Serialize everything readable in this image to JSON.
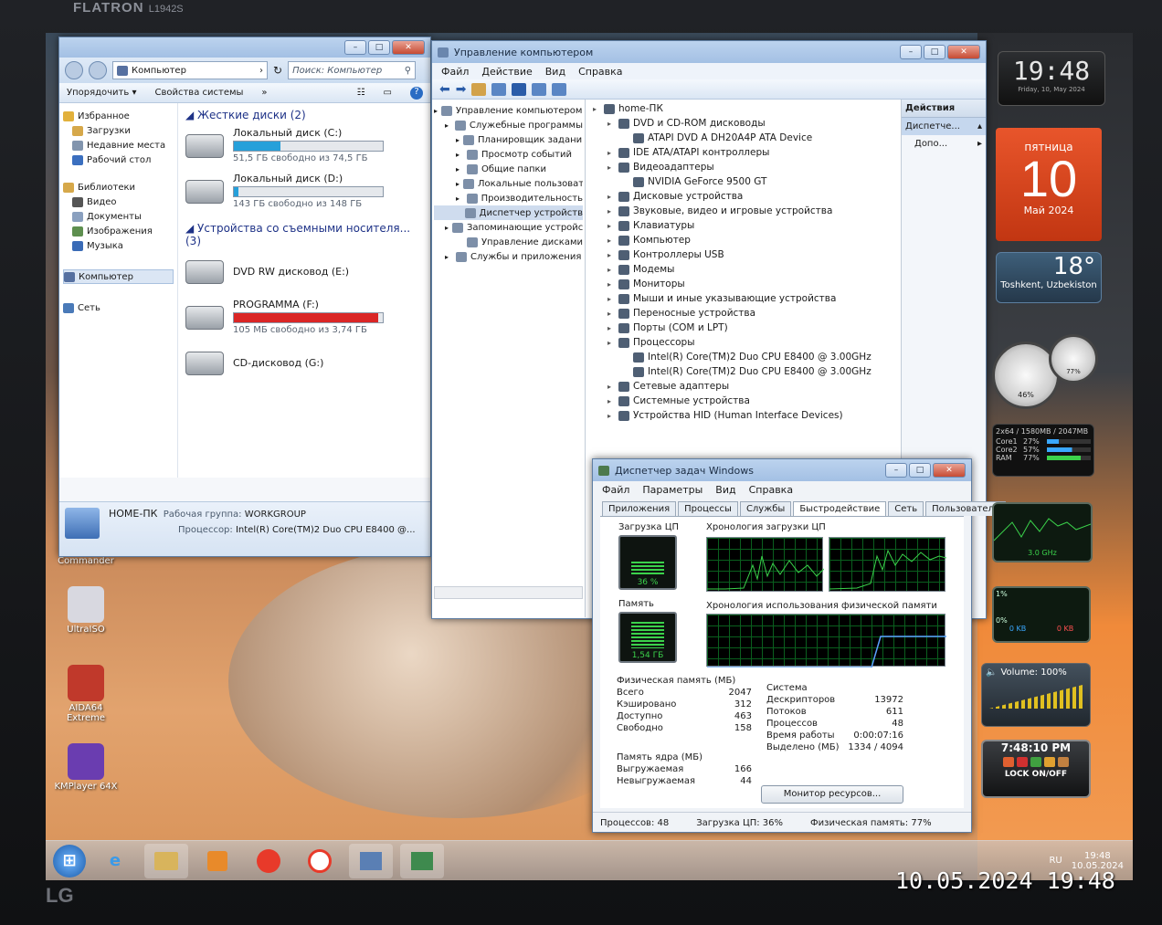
{
  "bezel": {
    "brand": "FLATRON",
    "model": "L1942S",
    "maker": "LG"
  },
  "photo_stamp": "10.05.2024  19:48",
  "explorer": {
    "address": "Компьютер",
    "search_placeholder": "Поиск: Компьютер",
    "organize": "Упорядочить",
    "system_props": "Свойства системы",
    "more": "»",
    "nav": {
      "favorites": "Избранное",
      "downloads": "Загрузки",
      "recent": "Недавние места",
      "desktop": "Рабочий стол",
      "libraries": "Библиотеки",
      "video": "Видео",
      "documents": "Документы",
      "images": "Изображения",
      "music": "Музыка",
      "computer": "Компьютер",
      "network": "Сеть"
    },
    "hdd_header": "Жесткие диски (2)",
    "removable_header": "Устройства со съемными носителя... (3)",
    "drives": [
      {
        "name": "Локальный диск (C:)",
        "free": "51,5 ГБ свободно из 74,5 ГБ",
        "used_fraction": 0.31,
        "color": "#26a0da"
      },
      {
        "name": "Локальный диск (D:)",
        "free": "143 ГБ свободно из 148 ГБ",
        "used_fraction": 0.03,
        "color": "#26a0da"
      }
    ],
    "removables": [
      {
        "name": "DVD RW дисковод (E:)"
      },
      {
        "name": "PROGRAMMA (F:)",
        "free": "105 МБ свободно из 3,74 ГБ",
        "used_fraction": 0.97,
        "color": "#da2626"
      },
      {
        "name": "CD-дисковод (G:)"
      }
    ],
    "status": {
      "pc": "HOME-ПК",
      "wg_label": "Рабочая группа:",
      "wg": "WORKGROUP",
      "cpu_label": "Процессор:",
      "cpu": "Intel(R) Core(TM)2 Duo CPU     E8400  @..."
    }
  },
  "mgmt": {
    "title": "Управление компьютером",
    "menu": [
      "Файл",
      "Действие",
      "Вид",
      "Справка"
    ],
    "tree": [
      {
        "label": "Управление компьютером (л",
        "lvl": 0
      },
      {
        "label": "Служебные программы",
        "lvl": 1
      },
      {
        "label": "Планировщик заданий",
        "lvl": 2
      },
      {
        "label": "Просмотр событий",
        "lvl": 2
      },
      {
        "label": "Общие папки",
        "lvl": 2
      },
      {
        "label": "Локальные пользовате",
        "lvl": 2
      },
      {
        "label": "Производительность",
        "lvl": 2
      },
      {
        "label": "Диспетчер устройств",
        "lvl": 2
      },
      {
        "label": "Запоминающие устройст",
        "lvl": 1
      },
      {
        "label": "Управление дисками",
        "lvl": 2
      },
      {
        "label": "Службы и приложения",
        "lvl": 1
      }
    ],
    "devices": [
      {
        "label": "home-ПК",
        "lvl": 0
      },
      {
        "label": "DVD и CD-ROM дисководы",
        "lvl": 1
      },
      {
        "label": "ATAPI DVD A  DH20A4P ATA Device",
        "lvl": 2
      },
      {
        "label": "IDE ATA/ATAPI контроллеры",
        "lvl": 1
      },
      {
        "label": "Видеоадаптеры",
        "lvl": 1
      },
      {
        "label": "NVIDIA GeForce 9500 GT",
        "lvl": 2
      },
      {
        "label": "Дисковые устройства",
        "lvl": 1
      },
      {
        "label": "Звуковые, видео и игровые устройства",
        "lvl": 1
      },
      {
        "label": "Клавиатуры",
        "lvl": 1
      },
      {
        "label": "Компьютер",
        "lvl": 1
      },
      {
        "label": "Контроллеры USB",
        "lvl": 1
      },
      {
        "label": "Модемы",
        "lvl": 1
      },
      {
        "label": "Мониторы",
        "lvl": 1
      },
      {
        "label": "Мыши и иные указывающие устройства",
        "lvl": 1
      },
      {
        "label": "Переносные устройства",
        "lvl": 1
      },
      {
        "label": "Порты (COM и LPT)",
        "lvl": 1
      },
      {
        "label": "Процессоры",
        "lvl": 1
      },
      {
        "label": "Intel(R) Core(TM)2 Duo CPU     E8400  @ 3.00GHz",
        "lvl": 2
      },
      {
        "label": "Intel(R) Core(TM)2 Duo CPU     E8400  @ 3.00GHz",
        "lvl": 2
      },
      {
        "label": "Сетевые адаптеры",
        "lvl": 1
      },
      {
        "label": "Системные устройства",
        "lvl": 1
      },
      {
        "label": "Устройства HID (Human Interface Devices)",
        "lvl": 1
      }
    ],
    "actions": {
      "title": "Действия",
      "item": "Диспетче...",
      "more": "Допо..."
    }
  },
  "taskmgr": {
    "title": "Диспетчер задач Windows",
    "menu": [
      "Файл",
      "Параметры",
      "Вид",
      "Справка"
    ],
    "tabs": [
      "Приложения",
      "Процессы",
      "Службы",
      "Быстродействие",
      "Сеть",
      "Пользователи"
    ],
    "active_tab": 3,
    "cpu_label": "Загрузка ЦП",
    "cpu_value": "36 %",
    "cpu_fraction": 0.36,
    "cpu_hist_label": "Хронология загрузки ЦП",
    "mem_label": "Память",
    "mem_value": "1,54 ГБ",
    "mem_fraction": 0.77,
    "mem_hist_label": "Хронология использования физической памяти",
    "phys_header": "Физическая память (МБ)",
    "phys": [
      [
        "Всего",
        "2047"
      ],
      [
        "Кэшировано",
        "312"
      ],
      [
        "Доступно",
        "463"
      ],
      [
        "Свободно",
        "158"
      ]
    ],
    "kernel_header": "Память ядра (МБ)",
    "kernel": [
      [
        "Выгружаемая",
        "166"
      ],
      [
        "Невыгружаемая",
        "44"
      ]
    ],
    "sys_header": "Система",
    "sys": [
      [
        "Дескрипторов",
        "13972"
      ],
      [
        "Потоков",
        "611"
      ],
      [
        "Процессов",
        "48"
      ],
      [
        "Время работы",
        "0:00:07:16"
      ],
      [
        "Выделено (МБ)",
        "1334 / 4094"
      ]
    ],
    "resmon": "Монитор ресурсов...",
    "status": {
      "procs": "Процессов: 48",
      "cpu": "Загрузка ЦП: 36%",
      "mem": "Физическая память: 77%"
    }
  },
  "desktop_icons": [
    {
      "label": "Total Commander",
      "color": "#c8c8c8"
    },
    {
      "label": "UltraISO",
      "color": "#d8d8e0"
    },
    {
      "label": "AIDA64 Extreme",
      "color": "#c0392b"
    },
    {
      "label": "KMPlayer 64X",
      "color": "#6a3db0"
    }
  ],
  "gadgets": {
    "clock": "19:48",
    "clock_date": "Friday, 10, May 2024",
    "calendar_weekday": "пятница",
    "calendar_day": "10",
    "calendar_month": "Май 2024",
    "weather_temp": "18°",
    "weather_city": "Toshkent, Uzbekiston",
    "cpu_gauge": "46%",
    "ram_gauge": "77%",
    "meter_header": "2x64 / 1580MB / 2047MB",
    "core1": "27%",
    "core2": "57%",
    "ram": "77%",
    "core1_label": "Core1",
    "core2_label": "Core2",
    "ram_label": "RAM",
    "freq": "3.0 GHz",
    "net_pct": "1%",
    "net_zero": "0%",
    "net_down": "0 KB",
    "net_up": "0 KB",
    "volume": "Volume: 100%",
    "lock_time": "7:48:10 PM",
    "lock_label": "LOCK ON/OFF"
  },
  "tray": {
    "lang": "RU",
    "time": "19:48",
    "date": "10.05.2024"
  }
}
